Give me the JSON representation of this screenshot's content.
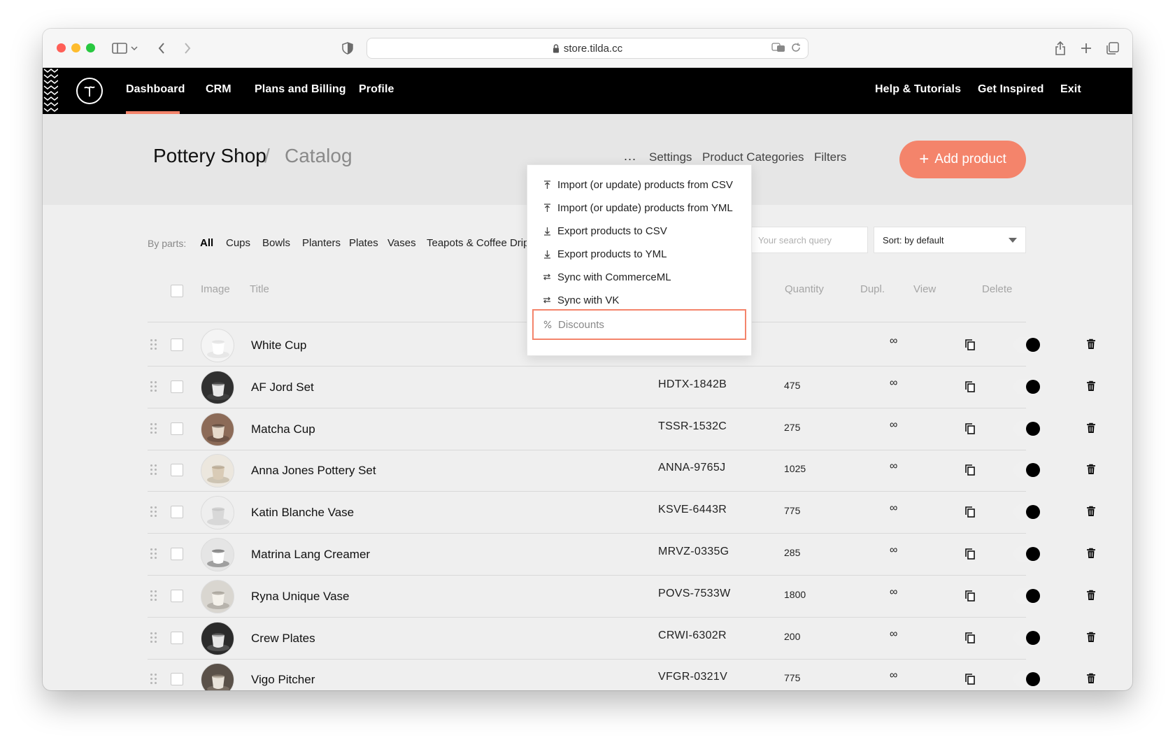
{
  "browser": {
    "url": "store.tilda.cc"
  },
  "nav": {
    "left": [
      "Dashboard",
      "CRM",
      "Plans and Billing",
      "Profile"
    ],
    "right": [
      "Help & Tutorials",
      "Get Inspired",
      "Exit"
    ],
    "active": "Dashboard"
  },
  "header": {
    "shop": "Pottery Shop",
    "separator": "/",
    "section": "Catalog",
    "more": "...",
    "links": [
      "Settings",
      "Product Categories",
      "Filters"
    ],
    "add_button": "Add product"
  },
  "filters": {
    "label": "By parts:",
    "parts": [
      "All",
      "Cups",
      "Bowls",
      "Planters",
      "Plates",
      "Vases",
      "Teapots & Coffee Dripp"
    ],
    "active": "All",
    "search_placeholder": "Your search query",
    "sort": "Sort: by default"
  },
  "dropdown": {
    "items": [
      {
        "label": "Import (or update) products from CSV",
        "icon": "upload-icon"
      },
      {
        "label": "Import (or update) products from YML",
        "icon": "upload-icon"
      },
      {
        "label": "Export products to CSV",
        "icon": "download-icon"
      },
      {
        "label": "Export products to YML",
        "icon": "download-icon"
      },
      {
        "label": "Sync with CommerceML",
        "icon": "sync-icon"
      },
      {
        "label": "Sync with VK",
        "icon": "sync-icon"
      }
    ],
    "discounts": {
      "label": "Discounts",
      "icon": "percent-icon"
    }
  },
  "table": {
    "headers": {
      "image": "Image",
      "title": "Title",
      "quantity": "Quantity",
      "dupl": "Dupl.",
      "view": "View",
      "delete": "Delete"
    },
    "rows": [
      {
        "title": "White Cup",
        "sku": "",
        "price": "",
        "qty": "∞",
        "visible": true
      },
      {
        "title": "AF Jord Set",
        "sku": "HDTX-1842B",
        "price": "475",
        "qty": "∞",
        "visible": true
      },
      {
        "title": "Matcha Cup",
        "sku": "TSSR-1532C",
        "price": "275",
        "qty": "∞",
        "visible": true
      },
      {
        "title": "Anna Jones Pottery Set",
        "sku": "ANNA-9765J",
        "price": "1025",
        "qty": "∞",
        "visible": true
      },
      {
        "title": "Katin Blanche Vase",
        "sku": "KSVE-6443R",
        "price": "775",
        "qty": "∞",
        "visible": true
      },
      {
        "title": "Matrina Lang Creamer",
        "sku": "MRVZ-0335G",
        "price": "285",
        "qty": "∞",
        "visible": true
      },
      {
        "title": "Ryna Unique Vase",
        "sku": "POVS-7533W",
        "price": "1800",
        "qty": "∞",
        "visible": true
      },
      {
        "title": "Crew Plates",
        "sku": "CRWI-6302R",
        "price": "200",
        "qty": "∞",
        "visible": true
      },
      {
        "title": "Vigo Pitcher",
        "sku": "VFGR-0321V",
        "price": "775",
        "qty": "∞",
        "visible": true
      }
    ]
  },
  "colors": {
    "accent": "#f4846b",
    "nav_bg": "#000000",
    "header_bg": "#e6e6e6",
    "page_bg": "#efefef"
  }
}
